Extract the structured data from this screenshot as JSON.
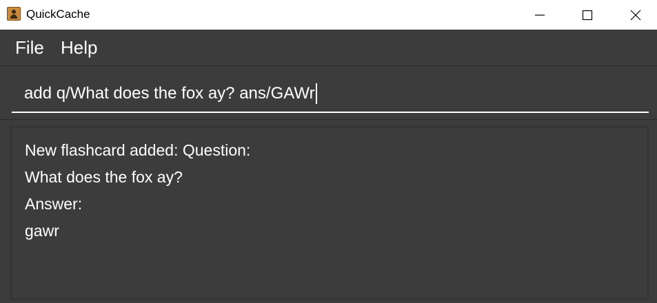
{
  "window": {
    "title": "QuickCache",
    "icon": "app-icon",
    "controls": [
      "minimize-icon",
      "maximize-icon",
      "close-icon"
    ]
  },
  "menu": {
    "items": [
      {
        "label": "File"
      },
      {
        "label": "Help"
      }
    ]
  },
  "command": {
    "value": "add q/What does the fox ay? ans/GAWr"
  },
  "result": {
    "lines": [
      "New flashcard added: Question:",
      "What does the fox ay?",
      "Answer:",
      "gawr"
    ]
  },
  "colors": {
    "background": "#3c3c3c",
    "text": "#ffffff",
    "titlebar": "#ffffff"
  }
}
